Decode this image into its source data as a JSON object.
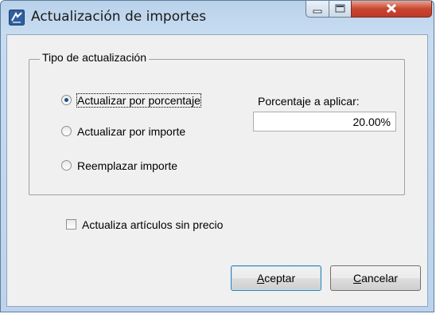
{
  "window": {
    "title": "Actualización de importes",
    "icon": "app-icon",
    "caption_buttons": [
      "minimize",
      "maximize",
      "close"
    ]
  },
  "group": {
    "legend": "Tipo de actualización",
    "options": [
      {
        "label": "Actualizar por porcentaje",
        "checked": true
      },
      {
        "label": "Actualizar por importe",
        "checked": false
      },
      {
        "label": "Reemplazar importe",
        "checked": false
      }
    ],
    "percentage_label": "Porcentaje a aplicar:",
    "percentage_value": "20.00%"
  },
  "checkbox": {
    "label": "Actualiza artículos sin precio",
    "checked": false
  },
  "buttons": {
    "accept": {
      "accel": "A",
      "rest": "ceptar"
    },
    "cancel": {
      "accel": "C",
      "rest": "ancelar"
    }
  }
}
